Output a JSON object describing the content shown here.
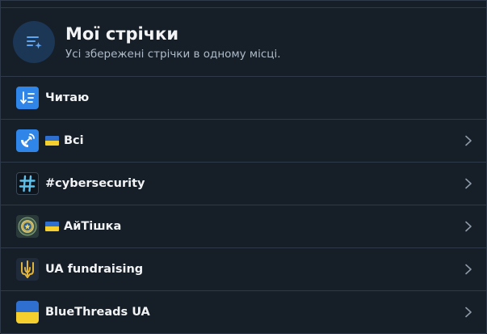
{
  "header": {
    "title": "Мої стрічки",
    "subtitle": "Усі збережені стрічки в одному місці."
  },
  "feeds": [
    {
      "label": "Читаю",
      "icon": "sort-list-icon",
      "flag": false,
      "chevron": false
    },
    {
      "label": "Всі",
      "icon": "satellite-dish-icon",
      "flag": true,
      "chevron": true
    },
    {
      "label": "#cybersecurity",
      "icon": "hashtag-icon",
      "flag": false,
      "chevron": true
    },
    {
      "label": "АйТішка",
      "icon": "emblem-icon",
      "flag": true,
      "chevron": true
    },
    {
      "label": "UA fundraising",
      "icon": "trident-icon",
      "flag": false,
      "chevron": true
    },
    {
      "label": "BlueThreads UA",
      "icon": "ukraine-flag-icon",
      "flag": false,
      "chevron": true
    }
  ],
  "colors": {
    "background": "#161e27",
    "divider": "#2e3a49",
    "accent": "#2f86e8",
    "flag_blue": "#2f6fd0",
    "flag_yellow": "#f5cf2e"
  }
}
